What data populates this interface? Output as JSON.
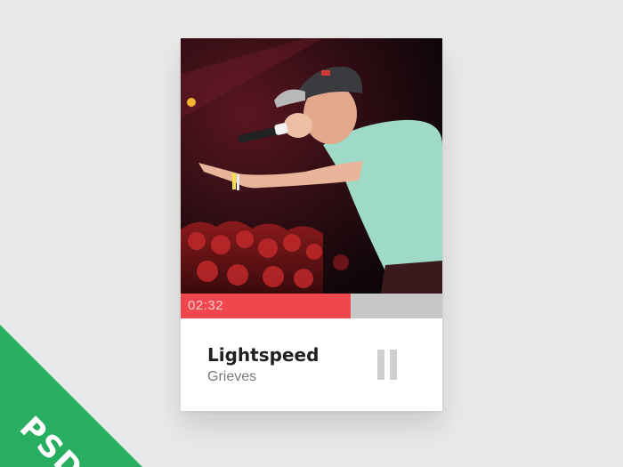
{
  "player": {
    "elapsed": "02:32",
    "progress": 0.65,
    "song_title": "Lightspeed",
    "artist": "Grieves",
    "accent_color": "#f0474e",
    "track_color": "#c6c6c6",
    "control_icon": "pause-icon"
  },
  "badge": {
    "label": "PSD",
    "color": "#27ae60"
  }
}
